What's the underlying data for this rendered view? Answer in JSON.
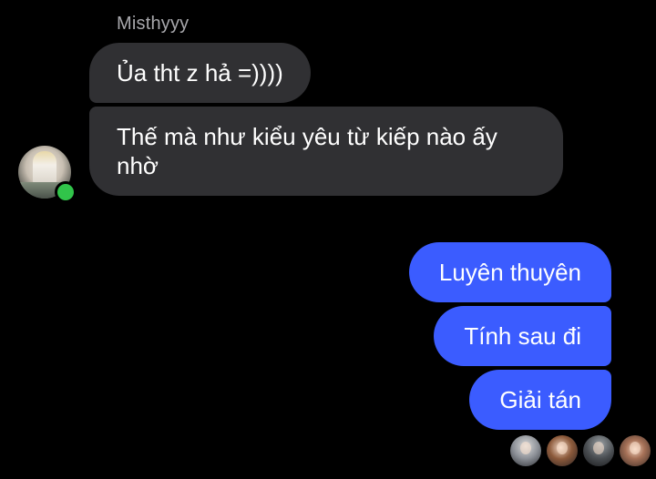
{
  "conversation": {
    "sender_name": "Misthyyy",
    "incoming_messages": [
      {
        "text": "Ủa tht z hả =))))"
      },
      {
        "text": "Thế mà như kiểu yêu từ kiếp nào ấy nhờ"
      }
    ],
    "outgoing_messages": [
      {
        "text": "Luyên thuyên"
      },
      {
        "text": "Tính sau đi"
      },
      {
        "text": "Giải tán"
      }
    ]
  },
  "sender_status": "online",
  "seen_by_count": 4,
  "colors": {
    "background": "#000000",
    "incoming_bubble": "#303033",
    "outgoing_bubble": "#3b5cff",
    "online_indicator": "#31c44a",
    "sender_name": "#a8a8ac"
  }
}
